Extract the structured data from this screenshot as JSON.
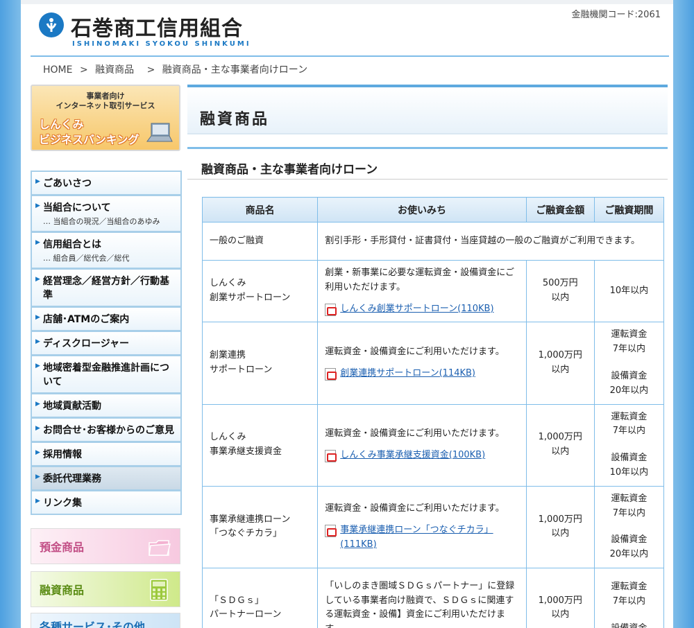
{
  "header": {
    "title": "石巻商工信用組合",
    "subtitle": "ISHINOMAKI SYOKOU SHINKUMI",
    "code": "金融機関コード:2061"
  },
  "breadcrumb": [
    "HOME",
    ">",
    "融資商品",
    ">",
    "融資商品・主な事業者向けローン"
  ],
  "banner": {
    "line1": "事業者向け",
    "line2": "インターネット取引サービス",
    "line3": "しんくみ",
    "line4": "ビジネスバンキング"
  },
  "nav": [
    {
      "label": "ごあいさつ",
      "sub": ""
    },
    {
      "label": "当組合について",
      "sub": "… 当組合の現況／当組合のあゆみ"
    },
    {
      "label": "信用組合とは",
      "sub": "… 組合員／総代会／総代"
    },
    {
      "label": "経営理念／経営方針／行動基準",
      "sub": ""
    },
    {
      "label": "店舗･ATMのご案内",
      "sub": ""
    },
    {
      "label": "ディスクロージャー",
      "sub": ""
    },
    {
      "label": "地域密着型金融推進計画について",
      "sub": ""
    },
    {
      "label": "地域貢献活動",
      "sub": ""
    },
    {
      "label": "お問合せ･お客様からのご意見",
      "sub": ""
    },
    {
      "label": "採用情報",
      "sub": ""
    },
    {
      "label": "委託代理業務",
      "sub": ""
    },
    {
      "label": "リンク集",
      "sub": ""
    }
  ],
  "products": {
    "deposit": "預金商品",
    "loan": "融資商品",
    "service": "各種サービス･その他"
  },
  "main": {
    "title": "融資商品",
    "section_title": "融資商品・主な事業者向けローン"
  },
  "table": {
    "headers": [
      "商品名",
      "お使いみち",
      "ご融資金額",
      "ご融資期間"
    ],
    "rows": [
      {
        "name": [
          "一般のご融資"
        ],
        "use": "割引手形・手形貸付・証書貸付・当座貸越の一般のご融資がご利用できます。",
        "link": "",
        "amount": [
          "",
          ""
        ],
        "period": []
      },
      {
        "name": [
          "しんくみ",
          "創業サポートローン"
        ],
        "use": "創業・新事業に必要な運転資金・設備資金にご利用いただけます。",
        "link": "しんくみ創業サポートローン(110KB)",
        "amount": [
          "500万円",
          "以内"
        ],
        "period": [
          "10年以内"
        ]
      },
      {
        "name": [
          "創業連携",
          "サポートローン"
        ],
        "use": "運転資金・設備資金にご利用いただけます。",
        "link": "創業連携サポートローン(114KB)",
        "amount": [
          "1,000万円",
          "以内"
        ],
        "period": [
          "運転資金",
          "7年以内",
          "",
          "設備資金",
          "20年以内"
        ]
      },
      {
        "name": [
          "しんくみ",
          "事業承継支援資金"
        ],
        "use": "運転資金・設備資金にご利用いただけます。",
        "link": "しんくみ事業承継支援資金(100KB)",
        "amount": [
          "1,000万円",
          "以内"
        ],
        "period": [
          "運転資金",
          "7年以内",
          "",
          "設備資金",
          "10年以内"
        ]
      },
      {
        "name": [
          "事業承継連携ローン",
          "「つなぐチカラ」"
        ],
        "use": "運転資金・設備資金にご利用いただけます。",
        "link": "事業承継連携ローン「つなぐチカラ」(111KB)",
        "amount": [
          "1,000万円",
          "以内"
        ],
        "period": [
          "運転資金",
          "7年以内",
          "",
          "設備資金",
          "20年以内"
        ]
      },
      {
        "name": [
          "「ＳＤＧｓ」",
          "パートナーローン"
        ],
        "use": "「いしのまき圏域ＳＤＧｓパートナー」に登録している事業者向け融資で、ＳＤＧｓに関連する運転資金・設備】資金にご利用いただけます。",
        "link": "",
        "amount": [
          "1,000万円",
          "以内"
        ],
        "period": [
          "運転資金",
          "7年以内",
          "",
          "設備資金"
        ]
      }
    ]
  },
  "colors": {
    "accent": "#1b79c4",
    "border": "#7fbde9",
    "link": "#1b5fb0"
  },
  "icons": [
    "logo-mark-icon",
    "pdf-icon",
    "laptop-icon",
    "folder-icon",
    "calculator-icon",
    "arrow-right-icon"
  ]
}
